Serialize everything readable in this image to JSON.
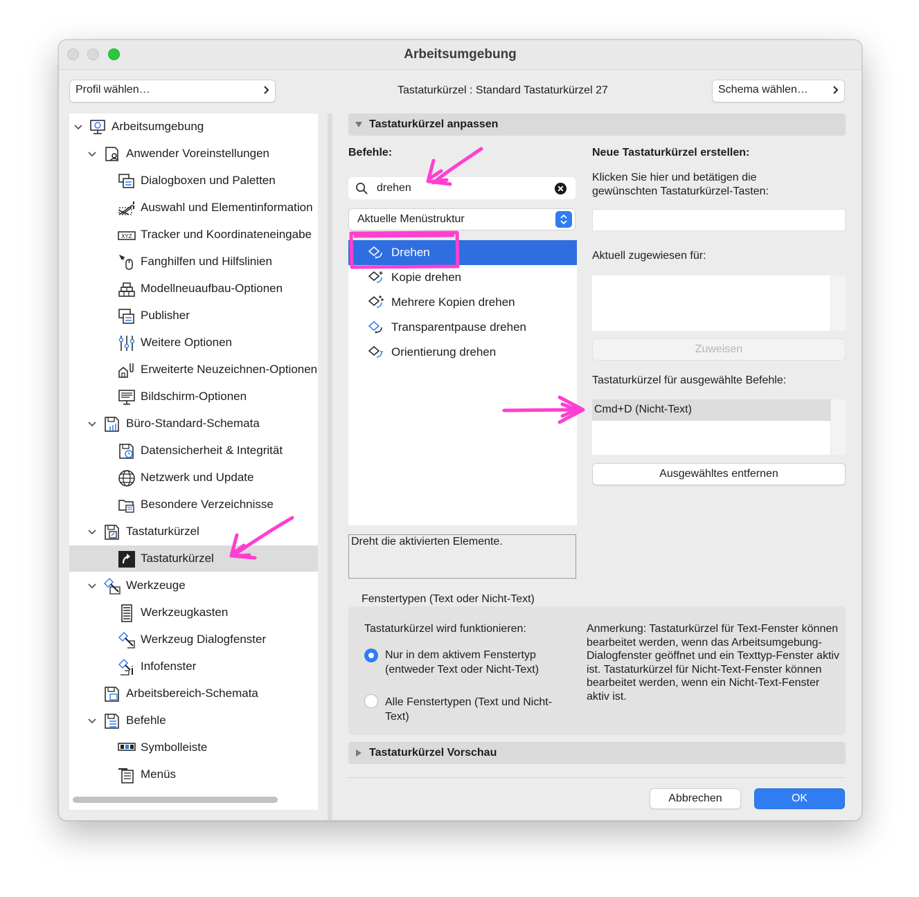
{
  "window": {
    "title": "Arbeitsumgebung",
    "profile_button": "Profil wählen…",
    "center_caption": "Tastaturkürzel :  Standard Tastaturkürzel 27",
    "schema_button": "Schema wählen…"
  },
  "sidebar": {
    "items": [
      {
        "label": "Arbeitsumgebung",
        "icon": "workspace-icon"
      },
      {
        "label": "Anwender Voreinstellungen",
        "icon": "user-prefs-icon"
      },
      {
        "label": "Dialogboxen und Paletten",
        "icon": "dialogs-icon"
      },
      {
        "label": "Auswahl und Elementinformation",
        "icon": "selection-info-icon"
      },
      {
        "label": "Tracker und Koordinateneingabe",
        "icon": "xyz-tracker-icon"
      },
      {
        "label": "Fanghilfen und Hilfslinien",
        "icon": "snap-guides-icon"
      },
      {
        "label": "Modellneuaufbau-Optionen",
        "icon": "model-rebuild-icon"
      },
      {
        "label": "Publisher",
        "icon": "publisher-icon"
      },
      {
        "label": "Weitere Optionen",
        "icon": "sliders-icon"
      },
      {
        "label": "Erweiterte Neuzeichnen-Optionen",
        "icon": "redraw-icon"
      },
      {
        "label": "Bildschirm-Optionen",
        "icon": "display-icon"
      },
      {
        "label": "Büro-Standard-Schemata",
        "icon": "office-schema-icon"
      },
      {
        "label": "Datensicherheit & Integrität",
        "icon": "data-safety-icon"
      },
      {
        "label": "Netzwerk und Update",
        "icon": "globe-icon"
      },
      {
        "label": "Besondere Verzeichnisse",
        "icon": "folder-icon"
      },
      {
        "label": "Tastaturkürzel",
        "icon": "shortcuts-group-icon"
      },
      {
        "label": "Tastaturkürzel",
        "icon": "shortcut-arrow-icon"
      },
      {
        "label": "Werkzeuge",
        "icon": "tools-icon"
      },
      {
        "label": "Werkzeugkasten",
        "icon": "toolbox-icon"
      },
      {
        "label": "Werkzeug Dialogfenster",
        "icon": "tool-dialog-icon"
      },
      {
        "label": "Infofenster",
        "icon": "info-window-icon"
      },
      {
        "label": "Arbeitsbereich-Schemata",
        "icon": "workspace-schema-icon"
      },
      {
        "label": "Befehle",
        "icon": "commands-icon"
      },
      {
        "label": "Symbolleiste",
        "icon": "toolbar-icon"
      },
      {
        "label": "Menüs",
        "icon": "menus-icon"
      }
    ]
  },
  "customize": {
    "header": "Tastaturkürzel anpassen",
    "commands_label": "Befehle:",
    "search_value": "drehen",
    "menu_structure": "Aktuelle Menüstruktur",
    "commands": [
      "Drehen",
      "Kopie drehen",
      "Mehrere Kopien drehen",
      "Transparentpause drehen",
      "Orientierung drehen"
    ],
    "description": "Dreht die aktivierten Elemente.",
    "new_shortcut_title": "Neue Tastaturkürzel erstellen:",
    "new_shortcut_hint": "Klicken Sie hier und betätigen die gewünschten Tastaturkürzel-Tasten:",
    "assigned_label": "Aktuell zugewiesen für:",
    "assign_button": "Zuweisen",
    "selected_shortcuts_label": "Tastaturkürzel für ausgewählte Befehle:",
    "selected_shortcut": "Cmd+D (Nicht-Text)",
    "remove_button": "Ausgewähltes entfernen"
  },
  "window_types": {
    "title": "Fenstertypen (Text oder Nicht-Text)",
    "will_work_label": "Tastaturkürzel wird funktionieren:",
    "option1": "Nur in dem aktivem Fenstertyp (entweder Text oder Nicht-Text)",
    "option2": "Alle Fenstertypen (Text und Nicht-Text)",
    "note": "Anmerkung: Tastaturkürzel für Text-Fenster können bearbeitet werden, wenn das Arbeitsumgebung-Dialogfenster geöffnet und ein Texttyp-Fenster aktiv ist. Tastaturkürzel für Nicht-Text-Fenster können bearbeitet werden, wenn ein Nicht-Text-Fenster aktiv ist."
  },
  "preview": {
    "header": "Tastaturkürzel Vorschau"
  },
  "footer": {
    "cancel": "Abbrechen",
    "ok": "OK"
  },
  "colors": {
    "accent": "#2f7df0",
    "annotation": "#ff3fd0",
    "selection": "#2f6ee0"
  }
}
